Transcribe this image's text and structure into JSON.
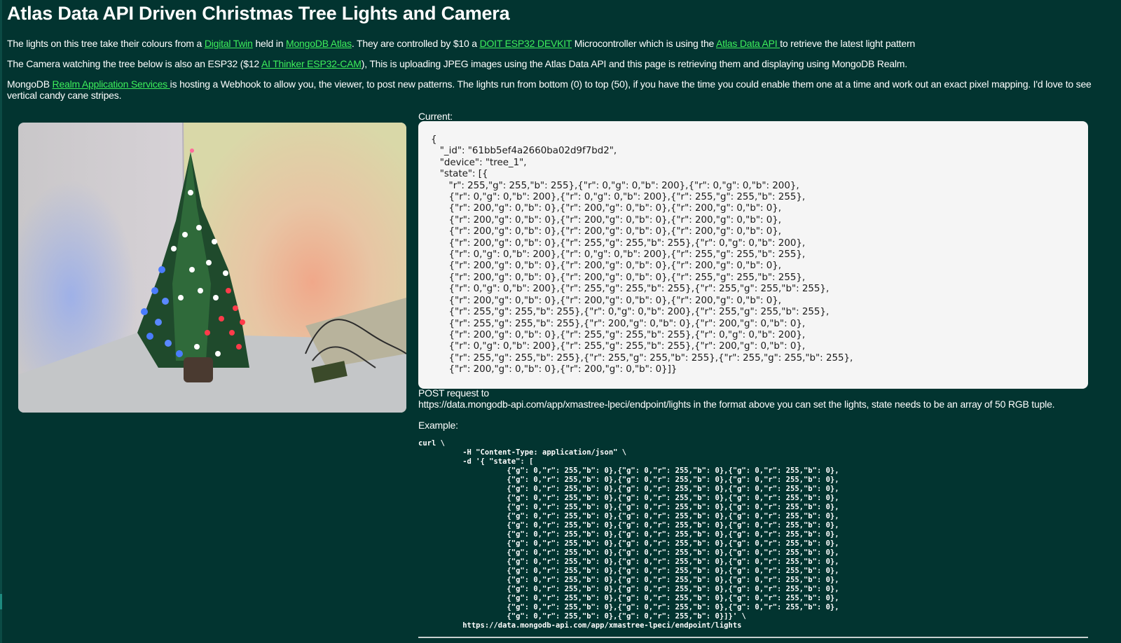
{
  "title": "Atlas Data API Driven Christmas Tree Lights and Camera",
  "intro": {
    "p1": {
      "t1": "The lights on this tree take their colours from a ",
      "link1": "Digital Twin",
      "t2": " held in ",
      "link2": "MongoDB Atlas",
      "t3": ". They are controlled by $10 a ",
      "link3": "DOIT ESP32 DEVKIT",
      "t4": " Microcontroller which is using the ",
      "link4": "Atlas Data API ",
      "t5": "to retrieve the latest light pattern"
    },
    "p2": {
      "t1": "The Camera watching the tree below is also an ESP32 ($12 ",
      "link1": "AI Thinker ESP32-CAM",
      "t2": "), This is uploading JPEG images using the Atlas Data API and this page is retrieving them and displaying using MongoDB Realm."
    },
    "p3": {
      "t1": "MongoDB ",
      "link1": "Realm Application Services ",
      "t2": "is hosting a Webhook to allow you, the viewer, to post new patterns. The lights run from bottom (0) to top (50), if you have the time you could enable them one at a time and work out an exact pixel mapping. I'd love to see vertical candy cane stripes."
    }
  },
  "current_label": "Current:",
  "current_json": "{\n   \"_id\": \"61bb5ef4a2660ba02d9f7bd2\",\n   \"device\": \"tree_1\",\n   \"state\": [{\n      \"r\": 255,\"g\": 255,\"b\": 255},{\"r\": 0,\"g\": 0,\"b\": 200},{\"r\": 0,\"g\": 0,\"b\": 200},\n      {\"r\": 0,\"g\": 0,\"b\": 200},{\"r\": 0,\"g\": 0,\"b\": 200},{\"r\": 255,\"g\": 255,\"b\": 255},\n      {\"r\": 200,\"g\": 0,\"b\": 0},{\"r\": 200,\"g\": 0,\"b\": 0},{\"r\": 200,\"g\": 0,\"b\": 0},\n      {\"r\": 200,\"g\": 0,\"b\": 0},{\"r\": 200,\"g\": 0,\"b\": 0},{\"r\": 200,\"g\": 0,\"b\": 0},\n      {\"r\": 200,\"g\": 0,\"b\": 0},{\"r\": 200,\"g\": 0,\"b\": 0},{\"r\": 200,\"g\": 0,\"b\": 0},\n      {\"r\": 200,\"g\": 0,\"b\": 0},{\"r\": 255,\"g\": 255,\"b\": 255},{\"r\": 0,\"g\": 0,\"b\": 200},\n      {\"r\": 0,\"g\": 0,\"b\": 200},{\"r\": 0,\"g\": 0,\"b\": 200},{\"r\": 255,\"g\": 255,\"b\": 255},\n      {\"r\": 200,\"g\": 0,\"b\": 0},{\"r\": 200,\"g\": 0,\"b\": 0},{\"r\": 200,\"g\": 0,\"b\": 0},\n      {\"r\": 200,\"g\": 0,\"b\": 0},{\"r\": 200,\"g\": 0,\"b\": 0},{\"r\": 255,\"g\": 255,\"b\": 255},\n      {\"r\": 0,\"g\": 0,\"b\": 200},{\"r\": 255,\"g\": 255,\"b\": 255},{\"r\": 255,\"g\": 255,\"b\": 255},\n      {\"r\": 200,\"g\": 0,\"b\": 0},{\"r\": 200,\"g\": 0,\"b\": 0},{\"r\": 200,\"g\": 0,\"b\": 0},\n      {\"r\": 255,\"g\": 255,\"b\": 255},{\"r\": 0,\"g\": 0,\"b\": 200},{\"r\": 255,\"g\": 255,\"b\": 255},\n      {\"r\": 255,\"g\": 255,\"b\": 255},{\"r\": 200,\"g\": 0,\"b\": 0},{\"r\": 200,\"g\": 0,\"b\": 0},\n      {\"r\": 200,\"g\": 0,\"b\": 0},{\"r\": 255,\"g\": 255,\"b\": 255},{\"r\": 0,\"g\": 0,\"b\": 200},\n      {\"r\": 0,\"g\": 0,\"b\": 200},{\"r\": 255,\"g\": 255,\"b\": 255},{\"r\": 200,\"g\": 0,\"b\": 0},\n      {\"r\": 255,\"g\": 255,\"b\": 255},{\"r\": 255,\"g\": 255,\"b\": 255},{\"r\": 255,\"g\": 255,\"b\": 255},\n      {\"r\": 200,\"g\": 0,\"b\": 0},{\"r\": 200,\"g\": 0,\"b\": 0}]}",
  "post_line1": "POST request to",
  "post_line2": "https://data.mongodb-api.com/app/xmastree-lpeci/endpoint/lights in the format above you can set the lights, state needs to be an array of 50 RGB tuple.",
  "example_label": "Example:",
  "curl_example": "curl \\\n          -H \"Content-Type: application/json\" \\\n          -d '{ \"state\": [\n                    {\"g\": 0,\"r\": 255,\"b\": 0},{\"g\": 0,\"r\": 255,\"b\": 0},{\"g\": 0,\"r\": 255,\"b\": 0},\n                    {\"g\": 0,\"r\": 255,\"b\": 0},{\"g\": 0,\"r\": 255,\"b\": 0},{\"g\": 0,\"r\": 255,\"b\": 0},\n                    {\"g\": 0,\"r\": 255,\"b\": 0},{\"g\": 0,\"r\": 255,\"b\": 0},{\"g\": 0,\"r\": 255,\"b\": 0},\n                    {\"g\": 0,\"r\": 255,\"b\": 0},{\"g\": 0,\"r\": 255,\"b\": 0},{\"g\": 0,\"r\": 255,\"b\": 0},\n                    {\"g\": 0,\"r\": 255,\"b\": 0},{\"g\": 0,\"r\": 255,\"b\": 0},{\"g\": 0,\"r\": 255,\"b\": 0},\n                    {\"g\": 0,\"r\": 255,\"b\": 0},{\"g\": 0,\"r\": 255,\"b\": 0},{\"g\": 0,\"r\": 255,\"b\": 0},\n                    {\"g\": 0,\"r\": 255,\"b\": 0},{\"g\": 0,\"r\": 255,\"b\": 0},{\"g\": 0,\"r\": 255,\"b\": 0},\n                    {\"g\": 0,\"r\": 255,\"b\": 0},{\"g\": 0,\"r\": 255,\"b\": 0},{\"g\": 0,\"r\": 255,\"b\": 0},\n                    {\"g\": 0,\"r\": 255,\"b\": 0},{\"g\": 0,\"r\": 255,\"b\": 0},{\"g\": 0,\"r\": 255,\"b\": 0},\n                    {\"g\": 0,\"r\": 255,\"b\": 0},{\"g\": 0,\"r\": 255,\"b\": 0},{\"g\": 0,\"r\": 255,\"b\": 0},\n                    {\"g\": 0,\"r\": 255,\"b\": 0},{\"g\": 0,\"r\": 255,\"b\": 0},{\"g\": 0,\"r\": 255,\"b\": 0},\n                    {\"g\": 0,\"r\": 255,\"b\": 0},{\"g\": 0,\"r\": 255,\"b\": 0},{\"g\": 0,\"r\": 255,\"b\": 0},\n                    {\"g\": 0,\"r\": 255,\"b\": 0},{\"g\": 0,\"r\": 255,\"b\": 0},{\"g\": 0,\"r\": 255,\"b\": 0},\n                    {\"g\": 0,\"r\": 255,\"b\": 0},{\"g\": 0,\"r\": 255,\"b\": 0},{\"g\": 0,\"r\": 255,\"b\": 0},\n                    {\"g\": 0,\"r\": 255,\"b\": 0},{\"g\": 0,\"r\": 255,\"b\": 0},{\"g\": 0,\"r\": 255,\"b\": 0},\n                    {\"g\": 0,\"r\": 255,\"b\": 0},{\"g\": 0,\"r\": 255,\"b\": 0},{\"g\": 0,\"r\": 255,\"b\": 0},\n                    {\"g\": 0,\"r\": 255,\"b\": 0},{\"g\": 0,\"r\": 255,\"b\": 0}]}' \\\n          https://data.mongodb-api.com/app/xmastree-lpeci/endpoint/lights",
  "colors": {
    "background": "#023430",
    "link": "#3dee5b",
    "panel": "#f5f5f5"
  }
}
